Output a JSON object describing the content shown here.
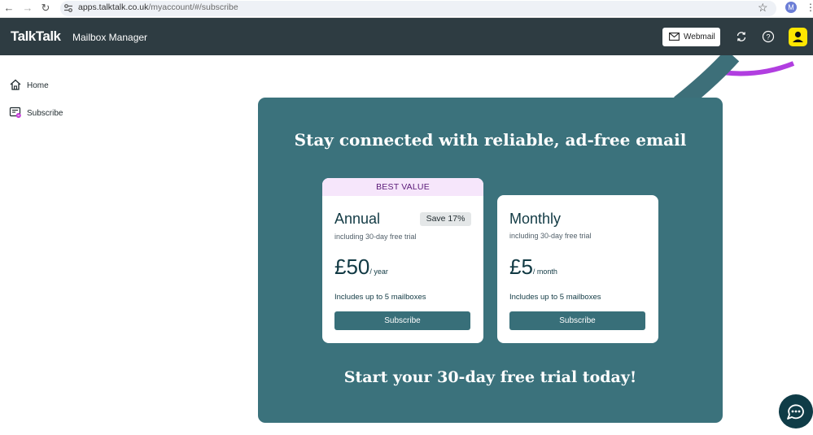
{
  "browser": {
    "url_host": "apps.talktalk.co.uk",
    "url_path": "/myaccount/#/subscribe",
    "profile_initial": "M"
  },
  "header": {
    "logo": "TalkTalk",
    "title": "Mailbox Manager",
    "webmail_label": "Webmail"
  },
  "sidebar": {
    "items": [
      {
        "label": "Home",
        "icon": "home-icon"
      },
      {
        "label": "Subscribe",
        "icon": "subscribe-icon"
      }
    ]
  },
  "promo": {
    "title": "Stay connected with reliable, ad-free email",
    "footer": "Start your 30-day free trial today!",
    "plans": [
      {
        "badge": "BEST VALUE",
        "name": "Annual",
        "save": "Save 17%",
        "trial": "including 30-day free trial",
        "price": "£50",
        "period": "/ year",
        "note": "Includes up to 5 mailboxes",
        "button": "Subscribe"
      },
      {
        "name": "Monthly",
        "trial": "including 30-day free trial",
        "price": "£5",
        "period": "/ month",
        "note": "Includes up to 5 mailboxes",
        "button": "Subscribe"
      }
    ]
  },
  "colors": {
    "header_bg": "#2e3c42",
    "panel_bg": "#3b727c",
    "button_bg": "#386f79",
    "accent_yellow": "#ffe600",
    "badge_bg": "#f6e6fb",
    "chat_bg": "#0f3c47"
  }
}
